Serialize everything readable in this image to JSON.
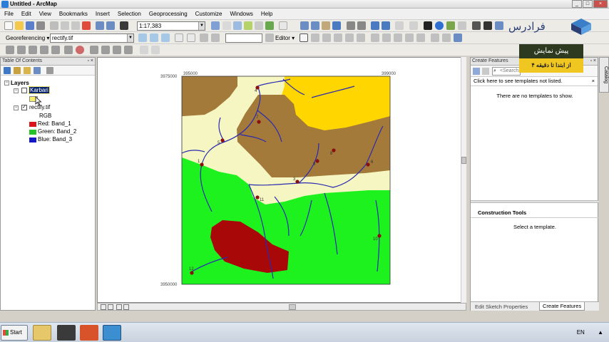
{
  "window": {
    "title": "Untitled - ArcMap"
  },
  "menu": [
    "File",
    "Edit",
    "View",
    "Bookmarks",
    "Insert",
    "Selection",
    "Geoprocessing",
    "Customize",
    "Windows",
    "Help"
  ],
  "toolbar1": {
    "scale": "1:17,383"
  },
  "toolbar2": {
    "georef_label": "Georeferencing ▾",
    "layer_value": "rectify.tif",
    "editor_label": "Editor ▾"
  },
  "toc": {
    "title": "Table Of Contents",
    "root": "Layers",
    "layer1": "Karbari",
    "layer2": "rectify.tif",
    "rgb": "RGB",
    "bands": [
      {
        "label": "Red:   Band_1",
        "color": "#d9141c"
      },
      {
        "label": "Green: Band_2",
        "color": "#27c227"
      },
      {
        "label": "Blue:  Band_3",
        "color": "#1418c8"
      }
    ]
  },
  "map": {
    "corner_tl": "395000",
    "corner_tr": "399000",
    "left_tick": "3975000",
    "bottom_left": "3950000",
    "points": [
      "4",
      "7",
      "5",
      "8",
      "9",
      "6",
      "1",
      "11",
      "10",
      "12",
      "3"
    ]
  },
  "create_features": {
    "title": "Create Features",
    "search_placeholder": "<Search>",
    "hint": "Click here to see templates not listed.",
    "empty": "There are no templates to show.",
    "construction_title": "Construction Tools",
    "construction_msg": "Select a template.",
    "tab1": "Edit Sketch Properties",
    "tab2": "Create Features"
  },
  "catalog_tab": "Catalog",
  "watermark": {
    "top": "پیش نمایش",
    "bottom": "از ابتدا تا دقیقه ۴",
    "logo": "فرادرس"
  },
  "taskbar": {
    "start": "Start",
    "lang": "EN"
  }
}
